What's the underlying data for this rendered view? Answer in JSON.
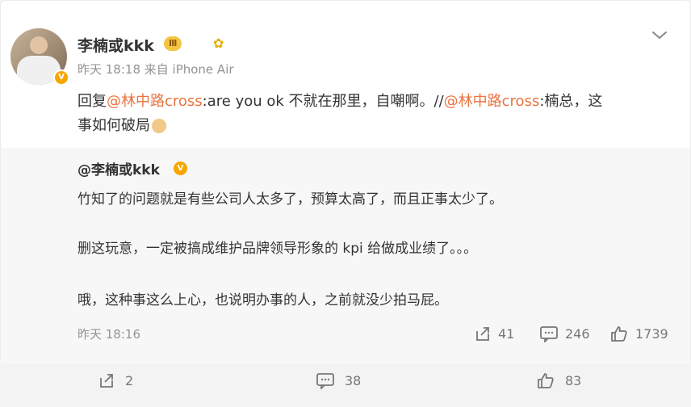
{
  "post": {
    "username": "李楠或kkk",
    "level": "Ⅲ",
    "meta": "昨天 18:18 来自 iPhone Air",
    "text": {
      "line1_prefix": "回复",
      "mention1": "@林中路cross",
      "line1_middle": ":are you ok 不就在那里，自嘲啊。//",
      "mention2": "@林中路cross",
      "line1_suffix": ":楠总，这",
      "line2": "事如何破局"
    }
  },
  "repost": {
    "username": "@李楠或kkk",
    "lines": [
      "竹知了的问题就是有些公司人太多了，预算太高了，而且正事太少了。",
      "删这玩意，一定被搞成维护品牌领导形象的 kpi 给做成业绩了。。。",
      "哦，这种事这么上心，也说明办事的人，之前就没少拍马屁。"
    ],
    "time": "昨天 18:16",
    "stats": {
      "reposts": "41",
      "comments": "246",
      "likes": "1739"
    }
  },
  "bottom_stats": {
    "reposts": "2",
    "comments": "38",
    "likes": "83"
  }
}
